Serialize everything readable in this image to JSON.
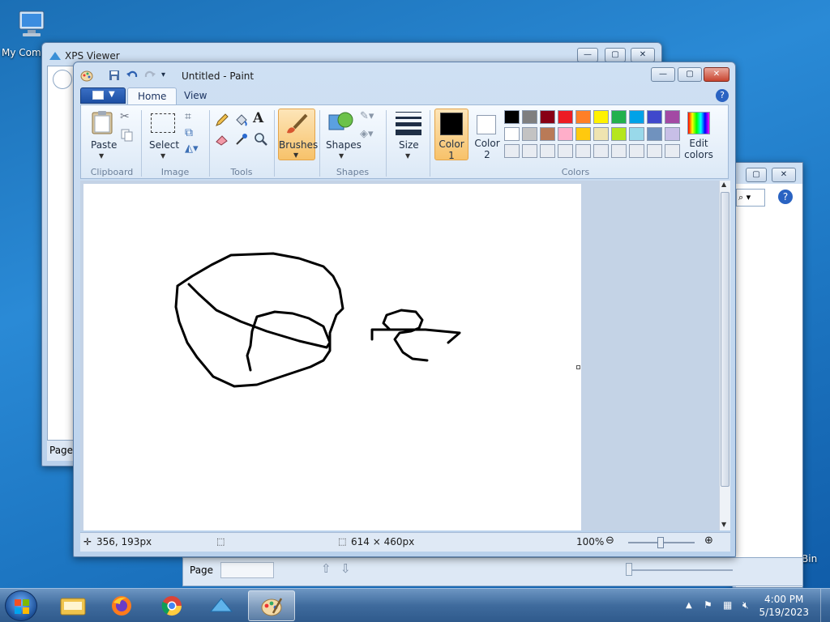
{
  "desktop": {
    "icon_label": "My Comp",
    "recycle_label": "Bin"
  },
  "xps_viewer": {
    "title": "XPS Viewer",
    "page_label": "Page"
  },
  "xps_viewer2": {
    "page_label": "Page"
  },
  "paint": {
    "title": "Untitled - Paint",
    "tabs": [
      "Home",
      "View"
    ],
    "groups": {
      "clipboard": "Clipboard",
      "image": "Image",
      "tools": "Tools",
      "shapes": "Shapes",
      "colors": "Colors"
    },
    "buttons": {
      "paste": "Paste",
      "select": "Select",
      "brushes": "Brushes",
      "shapes": "Shapes",
      "size": "Size",
      "color1": "Color\n1",
      "color1_a": "Color",
      "color1_b": "1",
      "color2_a": "Color",
      "color2_b": "2",
      "edit_colors_a": "Edit",
      "edit_colors_b": "colors"
    },
    "palette": [
      [
        "#000000",
        "#7f7f7f",
        "#880015",
        "#ed1c24",
        "#ff7f27",
        "#fff200",
        "#22b14c",
        "#00a2e8",
        "#3f48cc",
        "#a349a4"
      ],
      [
        "#ffffff",
        "#c3c3c3",
        "#b97a57",
        "#ffaec9",
        "#ffc90e",
        "#efe4b0",
        "#b5e61d",
        "#99d9ea",
        "#7092be",
        "#c8bfe7"
      ],
      [
        "#e8ecf2",
        "#e8ecf2",
        "#e8ecf2",
        "#e8ecf2",
        "#e8ecf2",
        "#e8ecf2",
        "#e8ecf2",
        "#e8ecf2",
        "#e8ecf2",
        "#e8ecf2"
      ]
    ],
    "color1": "#000000",
    "color2": "#ffffff",
    "status": {
      "cursor_pos": "356, 193px",
      "canvas_size": "614 × 460px",
      "zoom": "100%"
    }
  },
  "taskbar": {
    "time": "4:00 PM",
    "date": "5/19/2023",
    "pinned": [
      "windows-explorer",
      "firefox",
      "chrome",
      "xps-viewer",
      "paint"
    ]
  }
}
